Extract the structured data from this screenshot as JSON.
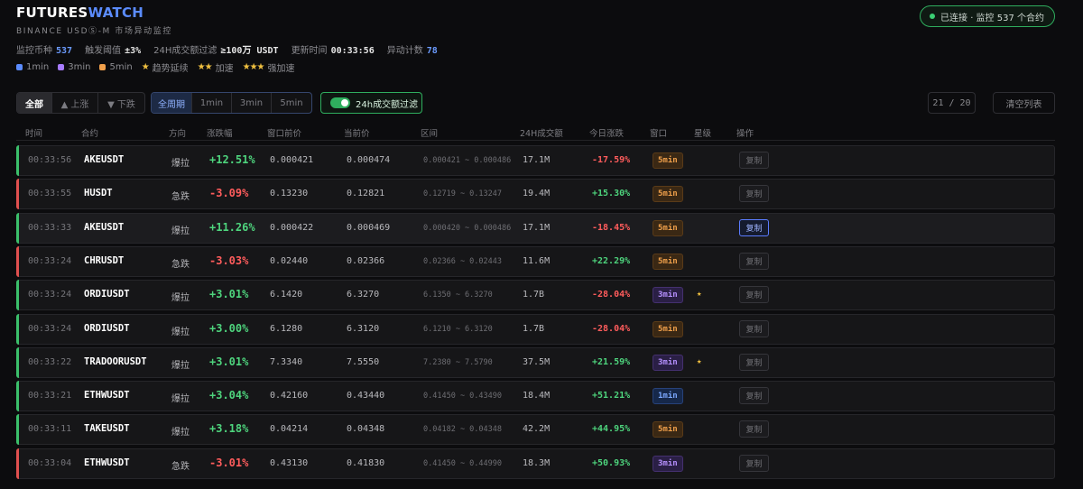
{
  "brand": {
    "part1": "FUTURES",
    "part2": "WATCH",
    "subtitle": "BINANCE USDⓈ-M 市场异动监控"
  },
  "connection": {
    "label": "已连接 · 监控 537 个合约"
  },
  "stats": [
    {
      "label": "监控币种",
      "value": "537",
      "accent": true
    },
    {
      "label": "触发阈值",
      "value": "±3%",
      "accent": false
    },
    {
      "label": "24H成交额过滤",
      "value": "≥100万 USDT",
      "accent": false
    },
    {
      "label": "更新时间",
      "value": "00:33:56",
      "accent": false
    },
    {
      "label": "异动计数",
      "value": "78",
      "accent": true
    }
  ],
  "legend": {
    "windows": [
      {
        "label": "1min",
        "color": "#5b8cff"
      },
      {
        "label": "3min",
        "color": "#a77bff"
      },
      {
        "label": "5min",
        "color": "#f0a04b"
      }
    ],
    "stars": [
      {
        "stars": "★",
        "label": "趋势延续"
      },
      {
        "stars": "★★",
        "label": "加速"
      },
      {
        "stars": "★★★",
        "label": "强加速"
      }
    ]
  },
  "filters": {
    "direction": [
      "全部",
      "▲ 上涨",
      "▼ 下跌"
    ],
    "period": [
      "全周期",
      "1min",
      "3min",
      "5min"
    ],
    "volume_filter": "24h成交额过滤",
    "pager": "21 / 20",
    "clear": "清空列表"
  },
  "columns": [
    "时间",
    "合约",
    "方向",
    "涨跌幅",
    "窗口前价",
    "当前价",
    "区间",
    "24H成交额",
    "今日涨跌",
    "窗口",
    "星级",
    "操作"
  ],
  "copy_label": "复制",
  "rows": [
    {
      "time": "00:33:56",
      "symbol": "AKEUSDT",
      "dir": "爆拉",
      "trend": "up",
      "change": "+12.51%",
      "pre": "0.000421",
      "cur": "0.000474",
      "range": "0.000421 ~ 0.000486",
      "vol": "17.1M",
      "today": "-17.59%",
      "today_sign": "neg",
      "win": "5min",
      "stars": ""
    },
    {
      "time": "00:33:55",
      "symbol": "HUSDT",
      "dir": "急跌",
      "trend": "down",
      "change": "-3.09%",
      "pre": "0.13230",
      "cur": "0.12821",
      "range": "0.12719 ~ 0.13247",
      "vol": "19.4M",
      "today": "+15.30%",
      "today_sign": "pos",
      "win": "5min",
      "stars": ""
    },
    {
      "time": "00:33:33",
      "symbol": "AKEUSDT",
      "dir": "爆拉",
      "trend": "up",
      "change": "+11.26%",
      "pre": "0.000422",
      "cur": "0.000469",
      "range": "0.000420 ~ 0.000486",
      "vol": "17.1M",
      "today": "-18.45%",
      "today_sign": "neg",
      "win": "5min",
      "stars": "",
      "highlight": true
    },
    {
      "time": "00:33:24",
      "symbol": "CHRUSDT",
      "dir": "急跌",
      "trend": "down",
      "change": "-3.03%",
      "pre": "0.02440",
      "cur": "0.02366",
      "range": "0.02366 ~ 0.02443",
      "vol": "11.6M",
      "today": "+22.29%",
      "today_sign": "pos",
      "win": "5min",
      "stars": ""
    },
    {
      "time": "00:33:24",
      "symbol": "ORDIUSDT",
      "dir": "爆拉",
      "trend": "up",
      "change": "+3.01%",
      "pre": "6.1420",
      "cur": "6.3270",
      "range": "6.1350 ~ 6.3270",
      "vol": "1.7B",
      "today": "-28.04%",
      "today_sign": "neg",
      "win": "3min",
      "stars": "★"
    },
    {
      "time": "00:33:24",
      "symbol": "ORDIUSDT",
      "dir": "爆拉",
      "trend": "up",
      "change": "+3.00%",
      "pre": "6.1280",
      "cur": "6.3120",
      "range": "6.1210 ~ 6.3120",
      "vol": "1.7B",
      "today": "-28.04%",
      "today_sign": "neg",
      "win": "5min",
      "stars": ""
    },
    {
      "time": "00:33:22",
      "symbol": "TRADOORUSDT",
      "dir": "爆拉",
      "trend": "up",
      "change": "+3.01%",
      "pre": "7.3340",
      "cur": "7.5550",
      "range": "7.2380 ~ 7.5790",
      "vol": "37.5M",
      "today": "+21.59%",
      "today_sign": "pos",
      "win": "3min",
      "stars": "★"
    },
    {
      "time": "00:33:21",
      "symbol": "ETHWUSDT",
      "dir": "爆拉",
      "trend": "up",
      "change": "+3.04%",
      "pre": "0.42160",
      "cur": "0.43440",
      "range": "0.41450 ~ 0.43490",
      "vol": "18.4M",
      "today": "+51.21%",
      "today_sign": "pos",
      "win": "1min",
      "stars": ""
    },
    {
      "time": "00:33:11",
      "symbol": "TAKEUSDT",
      "dir": "爆拉",
      "trend": "up",
      "change": "+3.18%",
      "pre": "0.04214",
      "cur": "0.04348",
      "range": "0.04182 ~ 0.04348",
      "vol": "42.2M",
      "today": "+44.95%",
      "today_sign": "pos",
      "win": "5min",
      "stars": ""
    },
    {
      "time": "00:33:04",
      "symbol": "ETHWUSDT",
      "dir": "急跌",
      "trend": "down",
      "change": "-3.01%",
      "pre": "0.43130",
      "cur": "0.41830",
      "range": "0.41450 ~ 0.44990",
      "vol": "18.3M",
      "today": "+50.93%",
      "today_sign": "pos",
      "win": "3min",
      "stars": ""
    }
  ]
}
